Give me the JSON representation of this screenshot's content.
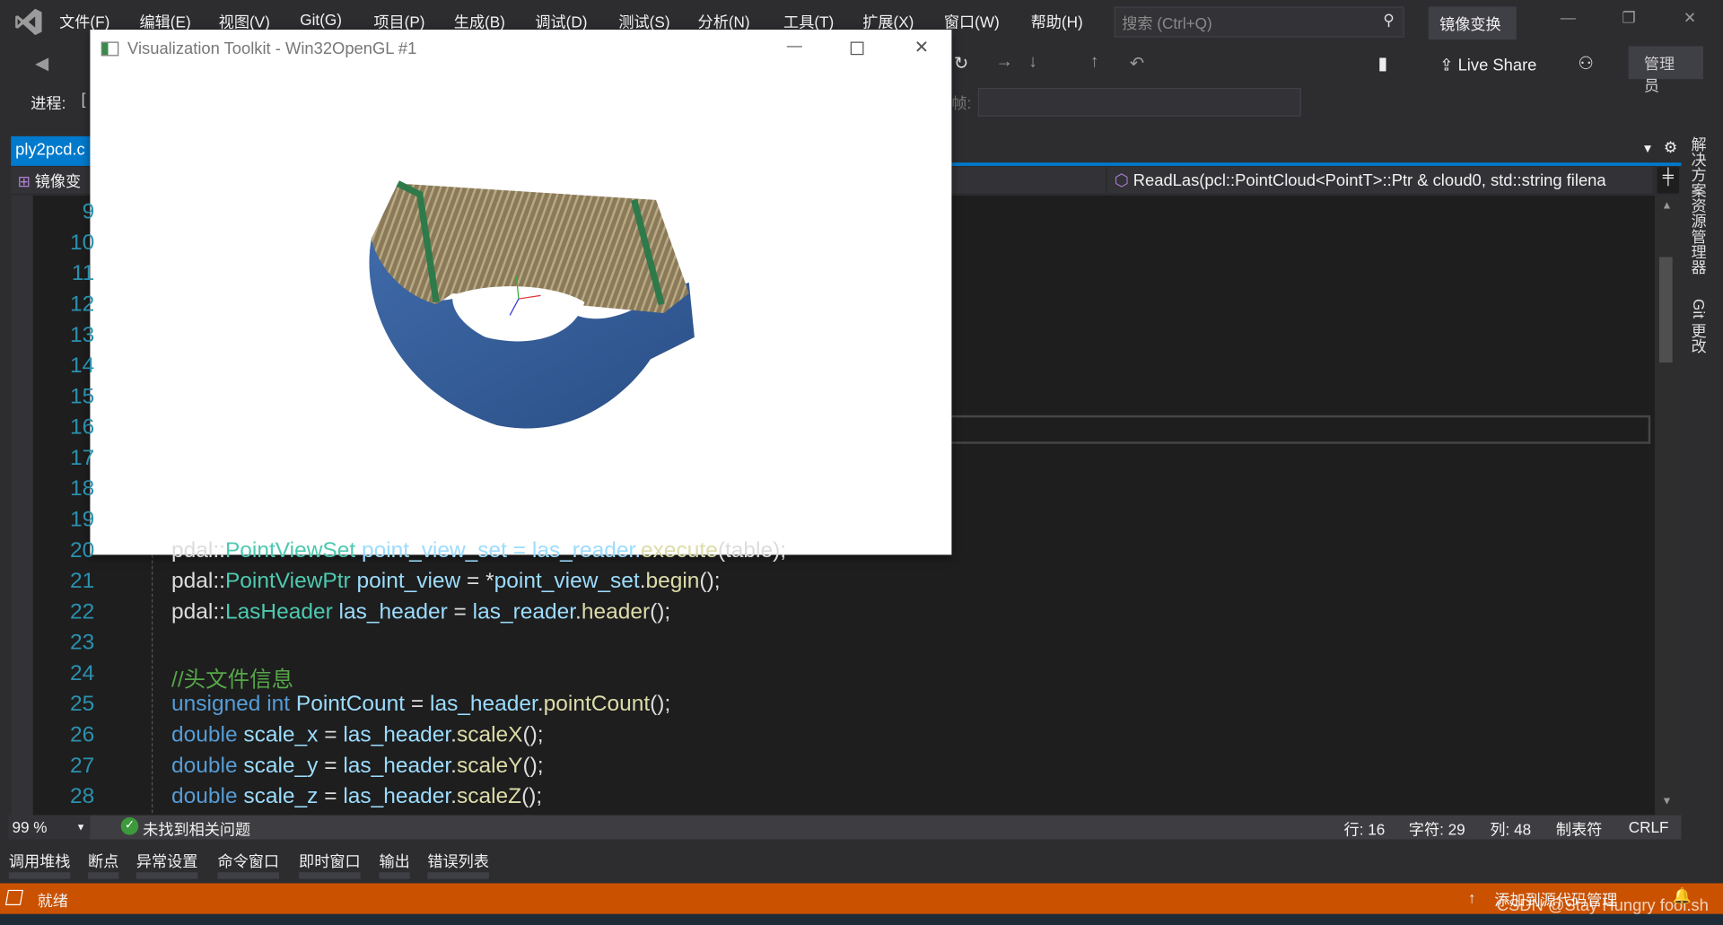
{
  "menu": [
    "文件(F)",
    "编辑(E)",
    "视图(V)",
    "Git(G)",
    "项目(P)",
    "生成(B)",
    "调试(D)",
    "测试(S)",
    "分析(N)",
    "工具(T)",
    "扩展(X)",
    "窗口(W)",
    "帮助(H)"
  ],
  "search_placeholder": "搜索 (Ctrl+Q)",
  "solution_name": "镜像变换",
  "live_share": "Live Share",
  "admin": "管理员",
  "process_label": "进程:",
  "process_value": "[",
  "frame_label": "帧:",
  "tab": {
    "label": "ply2pcd.c"
  },
  "project_dropdown": "镜像变",
  "function_dropdown": "ReadLas(pcl::PointCloud<PointT>::Ptr & cloud0, std::string filena",
  "side_panels": [
    "解决方案资源管理器",
    "Git 更改"
  ],
  "line_numbers": [
    "9",
    "10",
    "11",
    "12",
    "13",
    "14",
    "15",
    "16",
    "17",
    "18",
    "19",
    "20",
    "21",
    "22",
    "23",
    "24",
    "25",
    "26",
    "27",
    "28"
  ],
  "code": {
    "l20": [
      "pdal::",
      "PointViewSet",
      " point_view_set = las_reader.",
      "execute",
      "(table);"
    ],
    "l21": [
      "pdal::",
      "PointViewPtr",
      " point_view",
      " = *",
      "point_view_set",
      ".",
      "begin",
      "();"
    ],
    "l22": [
      "pdal::",
      "LasHeader",
      " las_header",
      " = ",
      "las_reader",
      ".",
      "header",
      "();"
    ],
    "l24": "//头文件信息",
    "l25": [
      "unsigned int",
      " PointCount",
      " = ",
      "las_header",
      ".",
      "pointCount",
      "();"
    ],
    "l26": [
      "double",
      " scale_x",
      " = ",
      "las_header",
      ".",
      "scaleX",
      "();"
    ],
    "l27": [
      "double",
      " scale_y",
      " = ",
      "las_header",
      ".",
      "scaleY",
      "();"
    ],
    "l28": [
      "double",
      " scale_z",
      " = ",
      "las_header",
      ".",
      "scaleZ",
      "();"
    ]
  },
  "status_strip": {
    "zoom": "99 %",
    "issues": "未找到相关问题",
    "line": "行: 16",
    "char": "字符: 29",
    "col": "列: 48",
    "tabs": "制表符",
    "eol": "CRLF"
  },
  "bottom_tabs": [
    "调用堆栈",
    "断点",
    "异常设置",
    "命令窗口",
    "即时窗口",
    "输出",
    "错误列表"
  ],
  "statusbar": {
    "ready": "就绪",
    "source_control": "添加到源代码管理",
    "watermark": "CSDN @Stay Hungry fool.sh"
  },
  "vtk_window": {
    "title": "Visualization Toolkit - Win32OpenGL #1"
  },
  "colors": {
    "accent": "#007acc",
    "statusbar": "#ca5100",
    "editor_bg": "#1e1e1e",
    "chrome": "#2d2d30"
  }
}
